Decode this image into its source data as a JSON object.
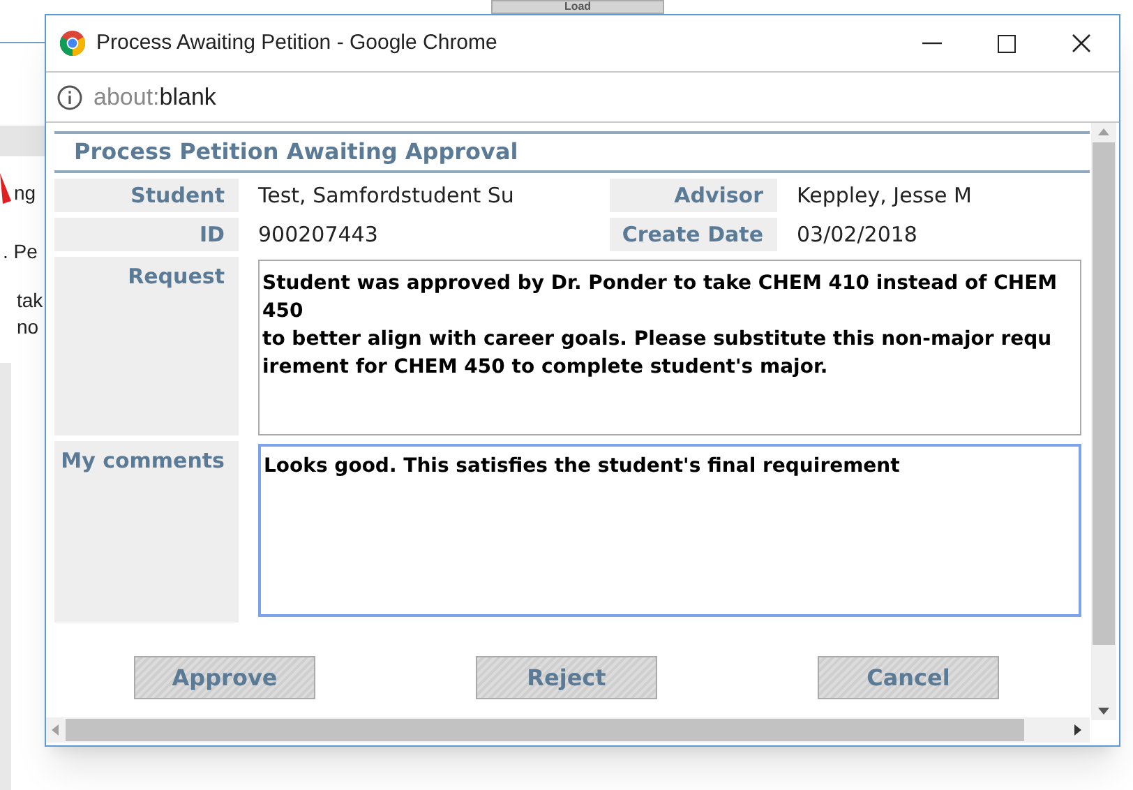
{
  "background_page": {
    "load_button": "Load",
    "fragments": [
      "ng",
      ". Pe",
      "tak",
      "no"
    ]
  },
  "window": {
    "title": "Process Awaiting Petition - Google Chrome",
    "address_scheme": "about:",
    "address_path": "blank"
  },
  "form": {
    "heading": "Process Petition Awaiting Approval",
    "fields": [
      {
        "label": "Student",
        "value": "Test, Samfordstudent Su"
      },
      {
        "label": "Advisor",
        "value": "Keppley, Jesse M"
      },
      {
        "label": "ID",
        "value": "900207443"
      },
      {
        "label": "Create Date",
        "value": "03/02/2018"
      }
    ],
    "request": {
      "label": "Request",
      "lines": [
        "Student was approved by Dr. Ponder to take CHEM 410 instead of CHEM",
        "450",
        "to better align with career goals. Please substitute this non-major requ",
        "irement for CHEM 450 to complete student's major."
      ]
    },
    "comments": {
      "label": "My comments",
      "value": "Looks good. This satisfies the student's final requirement",
      "focused": true
    },
    "buttons": [
      "Approve",
      "Reject",
      "Cancel"
    ]
  }
}
